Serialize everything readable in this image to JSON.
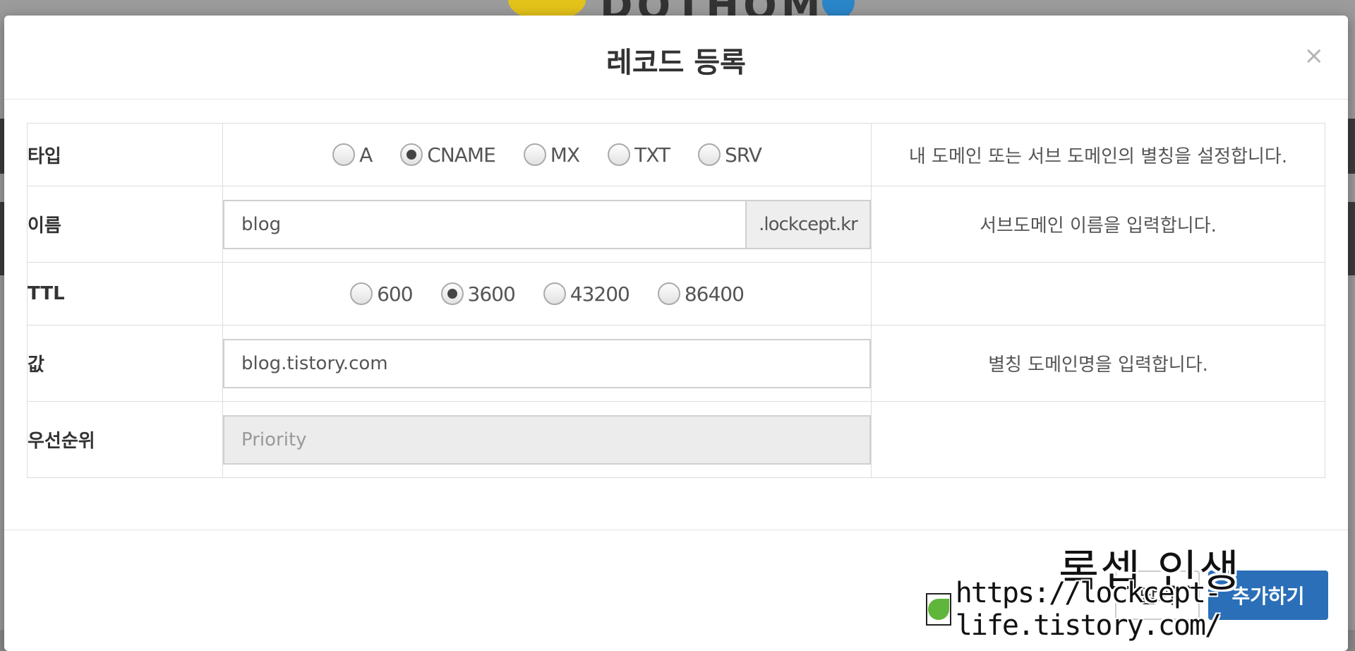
{
  "modal": {
    "title": "레코드 등록",
    "close_label": "×"
  },
  "form": {
    "type": {
      "label": "타입",
      "options": [
        "A",
        "CNAME",
        "MX",
        "TXT",
        "SRV"
      ],
      "selected": "CNAME",
      "help": "내 도메인 또는 서브 도메인의 별칭을 설정합니다."
    },
    "name": {
      "label": "이름",
      "value": "blog",
      "suffix": ".lockcept.kr",
      "help": "서브도메인 이름을 입력합니다."
    },
    "ttl": {
      "label": "TTL",
      "options": [
        "600",
        "3600",
        "43200",
        "86400"
      ],
      "selected": "3600",
      "help": ""
    },
    "value": {
      "label": "값",
      "value": "blog.tistory.com",
      "help": "별칭 도메인명을 입력합니다."
    },
    "priority": {
      "label": "우선순위",
      "placeholder": "Priority",
      "help": ""
    }
  },
  "footer": {
    "close_label": "닫기",
    "add_label": "추가하기"
  },
  "watermark": {
    "title": "록셉 인생",
    "url": "https://lockcept-life.tistory.com/"
  },
  "colors": {
    "primary_button": "#2a6fb8",
    "overlay": "#9b9b9b"
  }
}
